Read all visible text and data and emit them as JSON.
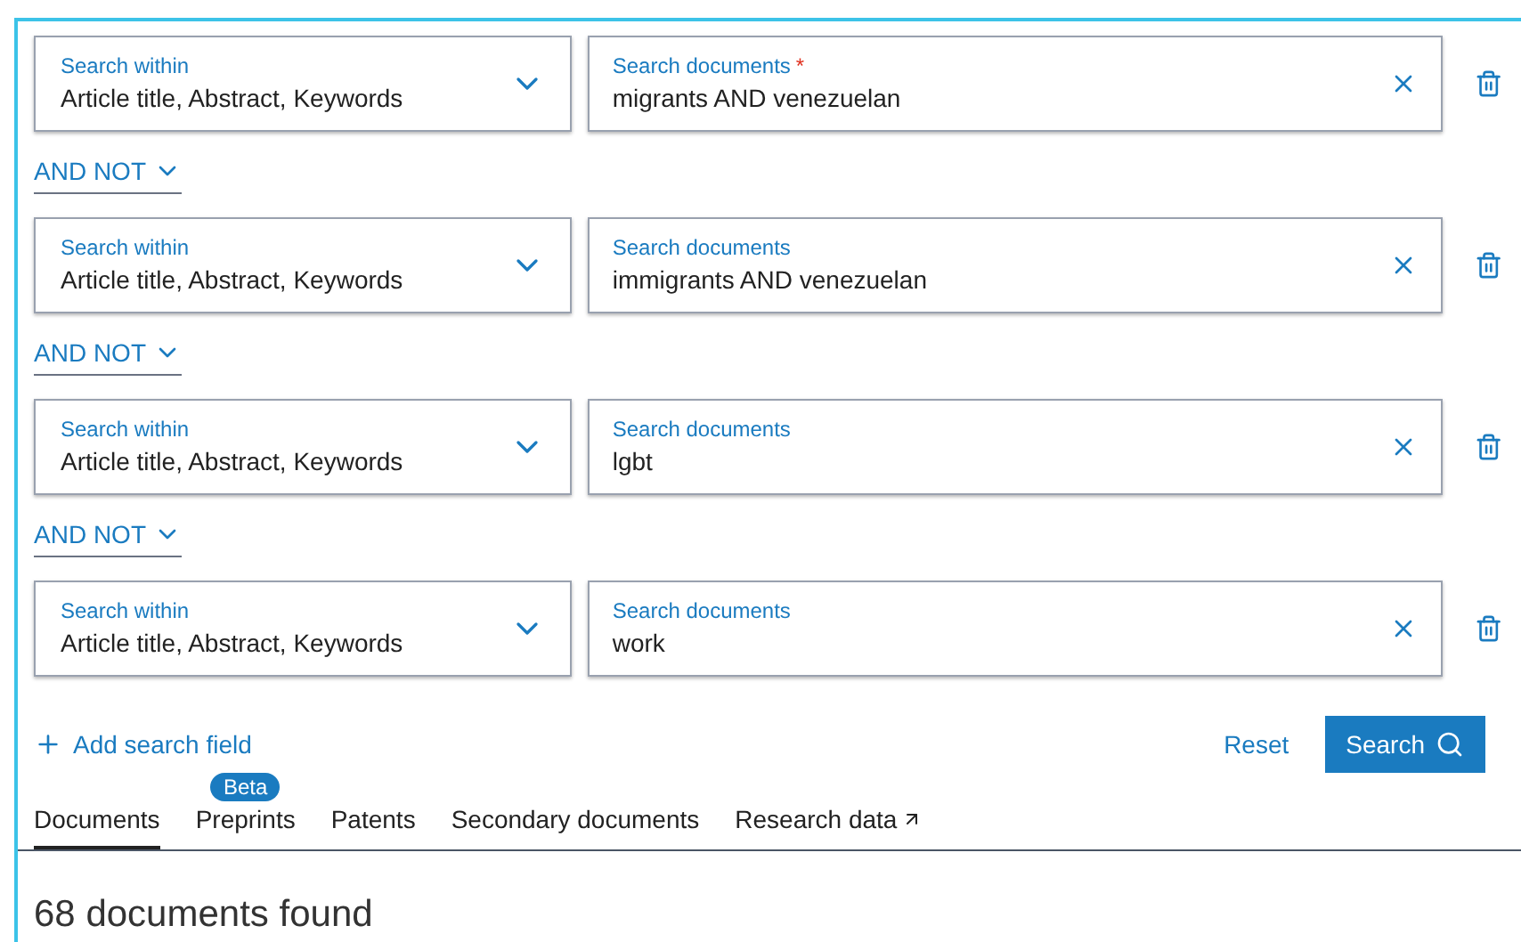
{
  "rows": [
    {
      "within_label": "Search within",
      "within_value": "Article title, Abstract, Keywords",
      "query_label": "Search documents",
      "required_mark": "*",
      "query": "migrants AND venezuelan"
    },
    {
      "operator": "AND NOT",
      "within_label": "Search within",
      "within_value": "Article title, Abstract, Keywords",
      "query_label": "Search documents",
      "query": "immigrants AND venezuelan"
    },
    {
      "operator": "AND NOT",
      "within_label": "Search within",
      "within_value": "Article title, Abstract, Keywords",
      "query_label": "Search documents",
      "query": "lgbt"
    },
    {
      "operator": "AND NOT",
      "within_label": "Search within",
      "within_value": "Article title, Abstract, Keywords",
      "query_label": "Search documents",
      "query": "work"
    }
  ],
  "add_field": "Add search field",
  "reset": "Reset",
  "search": "Search",
  "tabs": [
    {
      "label": "Documents",
      "selected": true
    },
    {
      "label": "Preprints",
      "selected": false,
      "badge": "Beta"
    },
    {
      "label": "Patents",
      "selected": false
    },
    {
      "label": "Secondary documents",
      "selected": false
    },
    {
      "label": "Research data",
      "selected": false,
      "external": true
    }
  ],
  "result_count": "68 documents found"
}
